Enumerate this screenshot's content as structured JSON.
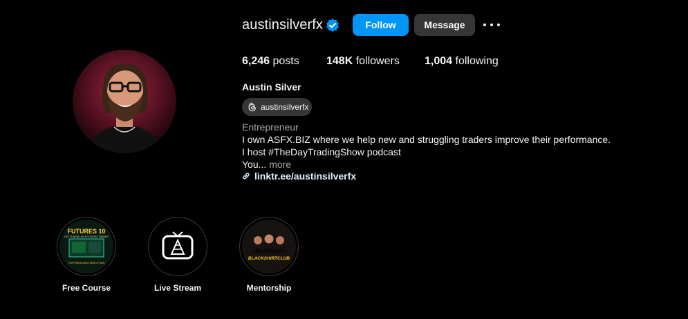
{
  "profile": {
    "username": "austinsilverfx",
    "verified": true,
    "follow_label": "Follow",
    "message_label": "Message",
    "posts_count": "6,246",
    "posts_label": "posts",
    "followers_count": "148K",
    "followers_label": "followers",
    "following_count": "1,004",
    "following_label": "following",
    "full_name": "Austin Silver",
    "threads_handle": "austinsilverfx",
    "category": "Entrepreneur",
    "bio_line1": "I own ASFX.BIZ where we help new and struggling traders improve their performance.",
    "bio_line2": "I host #TheDayTradingShow podcast",
    "bio_line3": "You...",
    "bio_more": "more",
    "link": "linktr.ee/austinsilverfx"
  },
  "highlights": [
    {
      "label": "Free Course",
      "image_text_top": "FUTURES 10",
      "image_text_sub": "GET FUNDED AS A FUTURES TRADER",
      "image_text_bottom": "FOR FREE ACCESS SIGN UP NOW"
    },
    {
      "label": "Live Stream"
    },
    {
      "label": "Mentorship",
      "image_text": "BLACKSHIRTCLUB"
    }
  ],
  "colors": {
    "follow_blue": "#0095f6",
    "message_gray": "#363636",
    "verified_blue": "#0095f6",
    "link_color": "#e0f1ff",
    "muted_text": "#a8a8a8"
  }
}
